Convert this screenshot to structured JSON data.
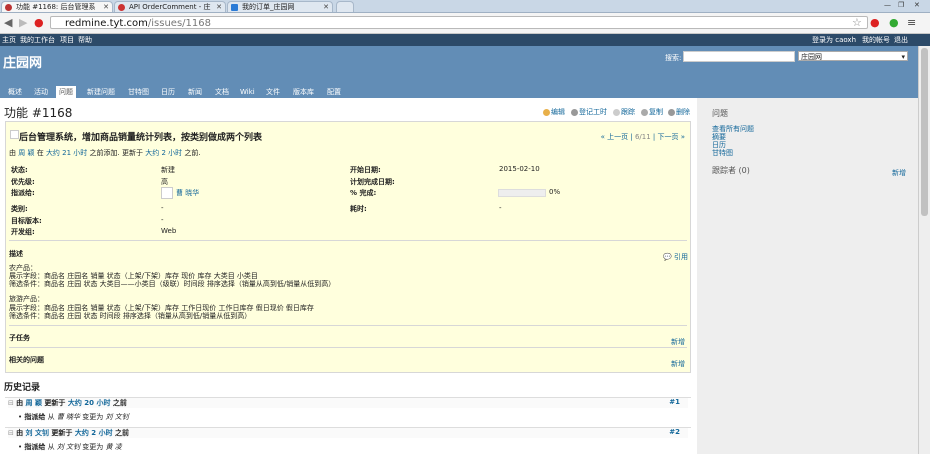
{
  "browser": {
    "tabs": [
      {
        "label": "功能 #1168: 后台管理系",
        "active": true
      },
      {
        "label": "API OrderComment - 庄",
        "active": false
      },
      {
        "label": "我的订单_庄园网",
        "active": false
      }
    ],
    "url_host": "redmine.tyt.com",
    "url_path": "/issues/1168"
  },
  "topmenu": {
    "left": [
      "主页",
      "我的工作台",
      "项目",
      "帮助"
    ],
    "logged_in": "登录为 caoxh",
    "my_account": "我的帐号",
    "logout": "退出"
  },
  "header": {
    "title": "庄园网",
    "search_label": "搜索:",
    "project_select": "庄园网"
  },
  "mainmenu": [
    "概述",
    "活动",
    "问题",
    "新建问题",
    "甘特图",
    "日历",
    "新闻",
    "文档",
    "Wiki",
    "文件",
    "版本库",
    "配置"
  ],
  "issue": {
    "title": "功能 #1168",
    "actions": [
      "编辑",
      "登记工时",
      "跟踪",
      "复制",
      "删除"
    ],
    "subject": "后台管理系统，增加商品销量统计列表，按类别做成两个列表",
    "prev": "« 上一页",
    "position": "6/11",
    "next": "下一页 »",
    "author_prefix": "由",
    "author": "周 颖",
    "added_mid": "在",
    "added_ago": "大约 21 小时",
    "added_suffix": "之前添加. 更新于",
    "updated_ago": "大约 2 小时",
    "updated_suffix": "之前.",
    "attributes": {
      "status_label": "状态:",
      "status": "新建",
      "priority_label": "优先级:",
      "priority": "高",
      "assignee_label": "指派给:",
      "assignee": "曹 晓华",
      "category_label": "类别:",
      "category": "-",
      "version_label": "目标版本:",
      "version": "-",
      "team_label": "开发组:",
      "team": "Web",
      "start_label": "开始日期:",
      "start": "2015-02-10",
      "due_label": "计划完成日期:",
      "due": "",
      "done_label": "% 完成:",
      "done_text": "0%",
      "spent_label": "耗时:",
      "spent": "-"
    },
    "done_ratio": 0,
    "description_label": "描述",
    "quote": "引用",
    "description": [
      "农产品：",
      "展示字段：商品名 庄园名 销量 状态（上架/下架）库存 现价 库存 大类目 小类目",
      "筛选条件：商品名 庄园 状态 大类目——小类目（级联）时间段 排序选择（销量从高到低/销量从低到高）",
      "",
      "旅游产品：",
      "展示字段：商品名 庄园名 销量 状态（上架/下架）库存 工作日现价 工作日库存 假日现价 假日库存",
      "筛选条件：商品名 庄园 状态 时间段 排序选择（销量从高到低/销量从低到高）"
    ],
    "subtasks_label": "子任务",
    "related_label": "相关的问题",
    "new_label": "新增"
  },
  "history": {
    "title": "历史记录",
    "journals": [
      {
        "by": "由",
        "user": "周 颖",
        "updated": "更新于",
        "ago": "大约 20 小时",
        "suffix": "之前",
        "num": "#1",
        "detail_label": "指派给",
        "detail_from": "从",
        "old": "曹 晓华",
        "detail_to": "变更为",
        "new": "刘 文钊"
      },
      {
        "by": "由",
        "user": "刘 文钊",
        "updated": "更新于",
        "ago": "大约 2 小时",
        "suffix": "之前",
        "num": "#2",
        "detail_label": "指派给",
        "detail_from": "从",
        "old": "刘 文钊",
        "detail_to": "变更为",
        "new": "黄 凌"
      }
    ]
  },
  "sidebar": {
    "issues_title": "问题",
    "links": [
      "查看所有问题",
      "摘要",
      "日历",
      "甘特图"
    ],
    "watchers_title": "跟踪者 (0)",
    "watchers_new": "新增"
  }
}
